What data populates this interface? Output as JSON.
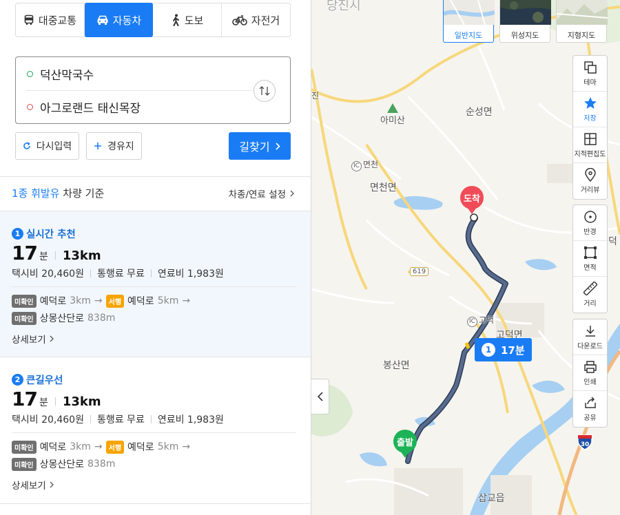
{
  "modes": [
    {
      "label": "대중교통",
      "icon": "bus-icon",
      "active": false
    },
    {
      "label": "자동차",
      "icon": "car-icon",
      "active": true
    },
    {
      "label": "도보",
      "icon": "walk-icon",
      "active": false
    },
    {
      "label": "자전거",
      "icon": "bicycle-icon",
      "active": false
    }
  ],
  "route": {
    "start": "덕산막국수",
    "end": "아그로랜드 태신목장"
  },
  "buttons": {
    "reset": "다시입력",
    "waypoint": "경유지",
    "search": "길찾기"
  },
  "vehicle": {
    "prefix": "1종 휘발유",
    "suffix": " 차량 기준",
    "setting": "차종/연료 설정"
  },
  "results": [
    {
      "rank": "1",
      "title": "실시간 추천",
      "minutes": "17",
      "minutes_unit": "분",
      "distance": "13km",
      "taxi": "택시비 20,460원",
      "toll": "통행료 무료",
      "fuel": "연료비 1,983원",
      "roads": [
        {
          "tag": "미확인",
          "name": "예덕로",
          "dist": "3km",
          "next_tag": "서행",
          "next_name": "예덕로",
          "next_dist": "5km"
        },
        {
          "tag": "미확인",
          "name": "상몽산단로",
          "dist": "838m"
        }
      ],
      "detail": "상세보기"
    },
    {
      "rank": "2",
      "title": "큰길우선",
      "minutes": "17",
      "minutes_unit": "분",
      "distance": "13km",
      "taxi": "택시비 20,460원",
      "toll": "통행료 무료",
      "fuel": "연료비 1,983원",
      "roads": [
        {
          "tag": "미확인",
          "name": "예덕로",
          "dist": "3km",
          "next_tag": "서행",
          "next_name": "예덕로",
          "next_dist": "5km"
        },
        {
          "tag": "미확인",
          "name": "상몽산단로",
          "dist": "838m"
        }
      ],
      "detail": "상세보기"
    }
  ],
  "map": {
    "map_types": [
      "일반지도",
      "위성지도",
      "지형지도"
    ],
    "tools_1": [
      {
        "label": "테마",
        "icon": "layers-icon"
      },
      {
        "label": "저장",
        "icon": "star-icon"
      },
      {
        "label": "지적편집도",
        "icon": "cadastral-icon"
      },
      {
        "label": "거리뷰",
        "icon": "streetview-icon"
      }
    ],
    "tools_2": [
      {
        "label": "반경",
        "icon": "radius-icon"
      },
      {
        "label": "면적",
        "icon": "area-icon"
      },
      {
        "label": "거리",
        "icon": "ruler-icon"
      }
    ],
    "tools_3": [
      {
        "label": "다운로드",
        "icon": "download-icon"
      },
      {
        "label": "인쇄",
        "icon": "print-icon"
      },
      {
        "label": "공유",
        "icon": "share-icon"
      }
    ],
    "labels": {
      "top_partial": "당진시",
      "jin": "진",
      "amisan": "아미산",
      "sunseong": "순성면",
      "ic_myeoncheon": "면천",
      "myeoncheon": "면천면",
      "road_619": "619",
      "ic_godeok": "고덕",
      "godeok": "고덕면",
      "bongsan": "봉산면",
      "sapgyo": "삽교읍",
      "deok": "덕",
      "hw30": "30"
    },
    "pin_end": "도착",
    "pin_start": "출발",
    "badge_rank": "1",
    "badge_time": "17분"
  },
  "colors": {
    "accent": "#1a7cf4",
    "end_pin": "#f14b58",
    "start_pin": "#1cb356",
    "route_line": "#4e5f7e"
  }
}
